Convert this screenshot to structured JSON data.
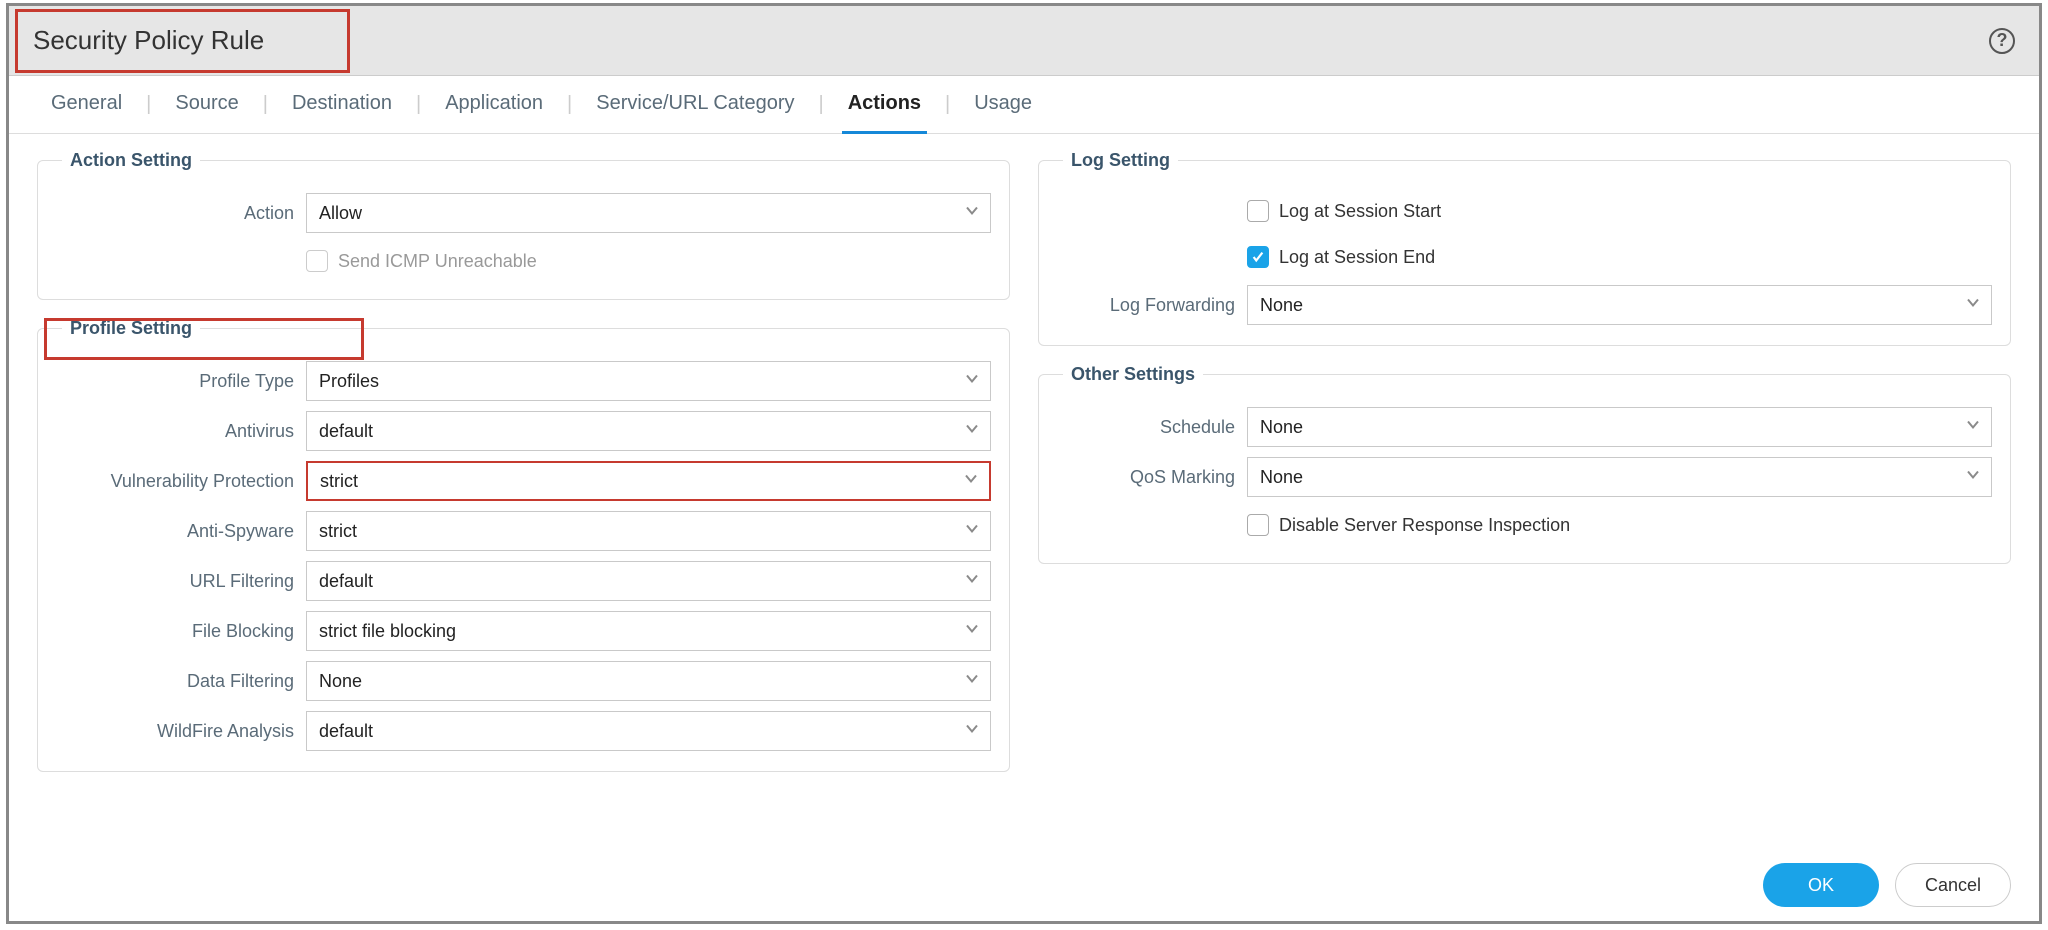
{
  "dialog": {
    "title": "Security Policy Rule"
  },
  "tabs": {
    "items": [
      {
        "label": "General"
      },
      {
        "label": "Source"
      },
      {
        "label": "Destination"
      },
      {
        "label": "Application"
      },
      {
        "label": "Service/URL Category"
      },
      {
        "label": "Actions"
      },
      {
        "label": "Usage"
      }
    ],
    "active_index": 5
  },
  "action_setting": {
    "legend": "Action Setting",
    "action_label": "Action",
    "action_value": "Allow",
    "send_icmp_label": "Send ICMP Unreachable",
    "send_icmp_checked": false
  },
  "profile_setting": {
    "legend": "Profile Setting",
    "rows": {
      "profile_type": {
        "label": "Profile Type",
        "value": "Profiles"
      },
      "antivirus": {
        "label": "Antivirus",
        "value": "default"
      },
      "vuln": {
        "label": "Vulnerability Protection",
        "value": "strict"
      },
      "antispy": {
        "label": "Anti-Spyware",
        "value": "strict"
      },
      "urlfilt": {
        "label": "URL Filtering",
        "value": "default"
      },
      "fileblock": {
        "label": "File Blocking",
        "value": "strict file blocking"
      },
      "datafilt": {
        "label": "Data Filtering",
        "value": "None"
      },
      "wildfire": {
        "label": "WildFire Analysis",
        "value": "default"
      }
    }
  },
  "log_setting": {
    "legend": "Log Setting",
    "log_start_label": "Log at Session Start",
    "log_start_checked": false,
    "log_end_label": "Log at Session End",
    "log_end_checked": true,
    "log_fwd_label": "Log Forwarding",
    "log_fwd_value": "None"
  },
  "other_settings": {
    "legend": "Other Settings",
    "schedule_label": "Schedule",
    "schedule_value": "None",
    "qos_label": "QoS Marking",
    "qos_value": "None",
    "dsri_label": "Disable Server Response Inspection",
    "dsri_checked": false
  },
  "footer": {
    "ok": "OK",
    "cancel": "Cancel"
  }
}
